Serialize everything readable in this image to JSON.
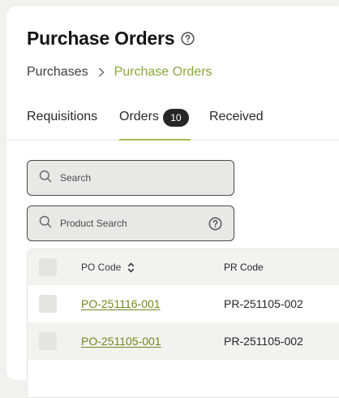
{
  "header": {
    "title": "Purchase Orders"
  },
  "breadcrumb": {
    "parent": "Purchases",
    "current": "Purchase Orders"
  },
  "tabs": [
    {
      "label": "Requisitions"
    },
    {
      "label": "Orders",
      "badge": "10",
      "active": true
    },
    {
      "label": "Received"
    }
  ],
  "search": {
    "placeholder": "Search",
    "product_placeholder": "Product Search"
  },
  "table": {
    "columns": {
      "po_code": "PO Code",
      "pr_code": "PR Code"
    },
    "rows": [
      {
        "po_code": "PO-251116-001",
        "pr_code": "PR-251105-002"
      },
      {
        "po_code": "PO-251105-001",
        "pr_code": "PR-251105-002"
      }
    ]
  },
  "colors": {
    "accent": "#8aa83a",
    "link": "#6f8a1f",
    "badge_bg": "#262626",
    "tab_underline": "#a6be50"
  },
  "icons": [
    "help-icon",
    "chevron-right-icon",
    "search-icon",
    "sort-icon"
  ]
}
